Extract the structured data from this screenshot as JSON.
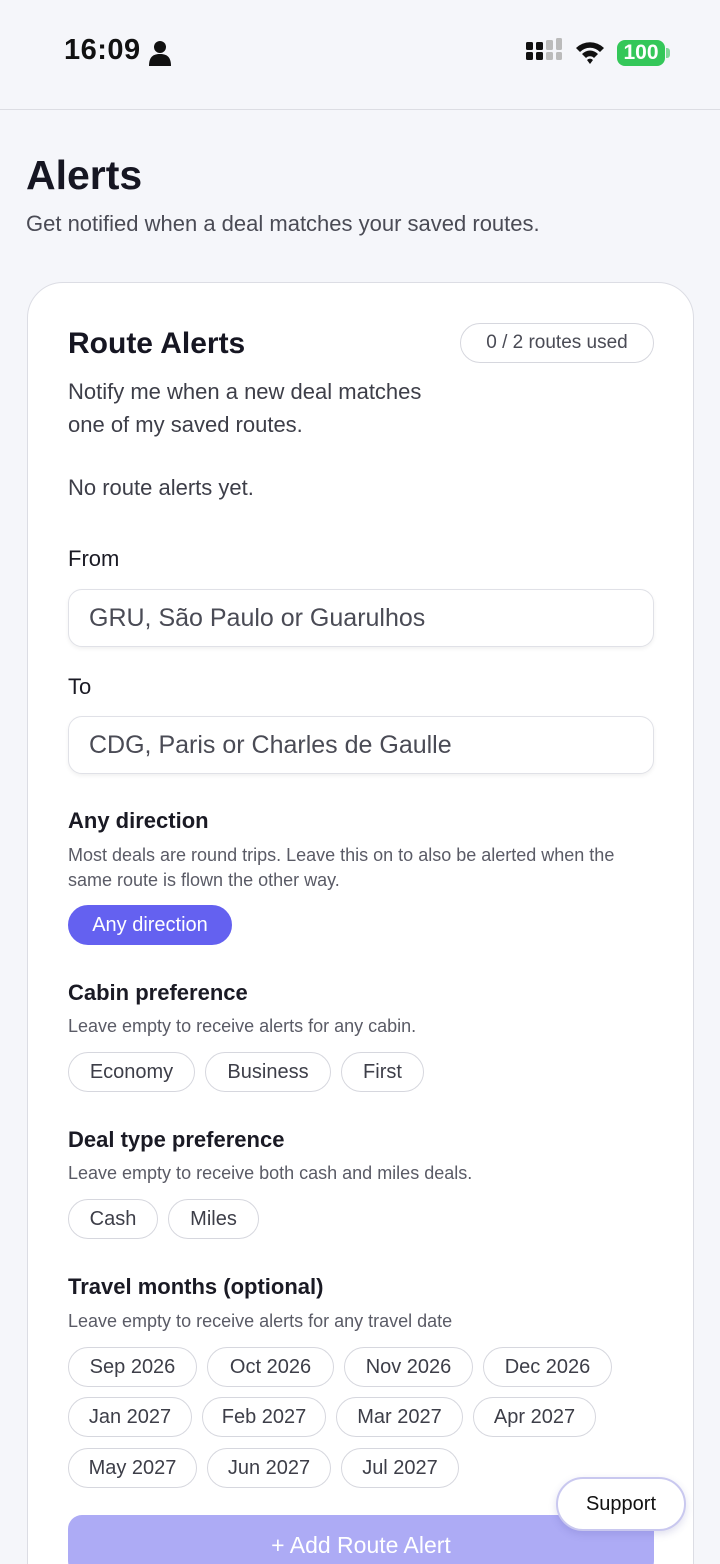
{
  "status_bar": {
    "time": "16:09",
    "battery": "100",
    "icons": [
      "person-icon",
      "signal-icon",
      "wifi-icon",
      "battery-icon"
    ]
  },
  "header": {
    "title": "Alerts",
    "subtitle": "Get notified when a deal matches your saved routes."
  },
  "route_alerts": {
    "title": "Route Alerts",
    "usage": "0 / 2 routes used",
    "description": "Notify me when a new deal matches one of my saved routes.",
    "empty_state": "No route alerts yet.",
    "from": {
      "label": "From",
      "placeholder": "GRU, São Paulo or Guarulhos"
    },
    "to": {
      "label": "To",
      "placeholder": "CDG, Paris or Charles de Gaulle"
    },
    "direction": {
      "title": "Any direction",
      "help": "Most deals are round trips. Leave this on to also be alerted when the same route is flown the other way.",
      "toggle_label": "Any direction",
      "toggle_on": true
    },
    "cabin": {
      "title": "Cabin preference",
      "help": "Leave empty to receive alerts for any cabin.",
      "options": [
        "Economy",
        "Business",
        "First"
      ]
    },
    "deal_type": {
      "title": "Deal type preference",
      "help": "Leave empty to receive both cash and miles deals.",
      "options": [
        "Cash",
        "Miles"
      ]
    },
    "months": {
      "title": "Travel months (optional)",
      "help": "Leave empty to receive alerts for any travel date",
      "options": [
        "Sep 2026",
        "Oct 2026",
        "Nov 2026",
        "Dec 2026",
        "Jan 2027",
        "Feb 2027",
        "Mar 2027",
        "Apr 2027",
        "May 2027",
        "Jun 2027",
        "Jul 2027"
      ]
    },
    "add_button": "+ Add Route Alert"
  },
  "support_button": "Support",
  "colors": {
    "accent": "#6461f0",
    "accent_disabled": "#adabf5",
    "battery": "#34c759"
  }
}
